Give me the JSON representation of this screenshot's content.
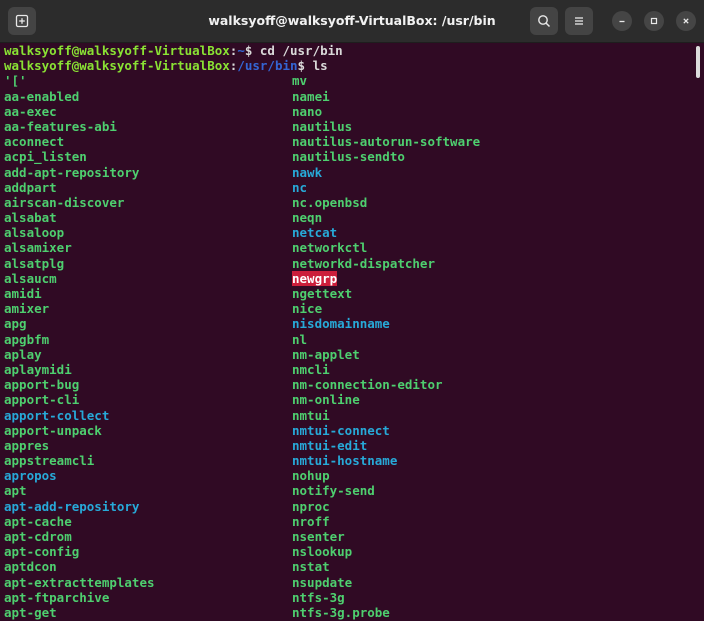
{
  "window": {
    "title": "walksyoff@walksyoff-VirtualBox: /usr/bin"
  },
  "titlebar_icons": {
    "new_tab": "new-tab-icon",
    "search": "search-icon",
    "menu": "hamburger-menu-icon",
    "minimize": "minimize-icon",
    "maximize": "maximize-icon",
    "close": "close-icon"
  },
  "colors": {
    "background": "#300a24",
    "prompt_user": "#8ae234",
    "prompt_path": "#3465d4",
    "executable": "#4ecf6f",
    "symlink": "#27a9d8",
    "setgid_highlight": "#cc1e3b"
  },
  "terminal": {
    "prompts": [
      {
        "user": "walksyoff@walksyoff-VirtualBox",
        "sep": ":",
        "path": "~",
        "sign": "$",
        "command": " cd /usr/bin"
      },
      {
        "user": "walksyoff@walksyoff-VirtualBox",
        "sep": ":",
        "path": "/usr/bin",
        "sign": "$",
        "command": " ls"
      }
    ],
    "col1": [
      {
        "t": "'['",
        "k": "exec"
      },
      {
        "t": "aa-enabled",
        "k": "exec"
      },
      {
        "t": "aa-exec",
        "k": "exec"
      },
      {
        "t": "aa-features-abi",
        "k": "exec"
      },
      {
        "t": "aconnect",
        "k": "exec"
      },
      {
        "t": "acpi_listen",
        "k": "exec"
      },
      {
        "t": "add-apt-repository",
        "k": "exec"
      },
      {
        "t": "addpart",
        "k": "exec"
      },
      {
        "t": "airscan-discover",
        "k": "exec"
      },
      {
        "t": "alsabat",
        "k": "exec"
      },
      {
        "t": "alsaloop",
        "k": "exec"
      },
      {
        "t": "alsamixer",
        "k": "exec"
      },
      {
        "t": "alsatplg",
        "k": "exec"
      },
      {
        "t": "alsaucm",
        "k": "exec"
      },
      {
        "t": "amidi",
        "k": "exec"
      },
      {
        "t": "amixer",
        "k": "exec"
      },
      {
        "t": "apg",
        "k": "exec"
      },
      {
        "t": "apgbfm",
        "k": "exec"
      },
      {
        "t": "aplay",
        "k": "exec"
      },
      {
        "t": "aplaymidi",
        "k": "exec"
      },
      {
        "t": "apport-bug",
        "k": "exec"
      },
      {
        "t": "apport-cli",
        "k": "exec"
      },
      {
        "t": "apport-collect",
        "k": "link"
      },
      {
        "t": "apport-unpack",
        "k": "exec"
      },
      {
        "t": "appres",
        "k": "exec"
      },
      {
        "t": "appstreamcli",
        "k": "exec"
      },
      {
        "t": "apropos",
        "k": "link"
      },
      {
        "t": "apt",
        "k": "exec"
      },
      {
        "t": "apt-add-repository",
        "k": "link"
      },
      {
        "t": "apt-cache",
        "k": "exec"
      },
      {
        "t": "apt-cdrom",
        "k": "exec"
      },
      {
        "t": "apt-config",
        "k": "exec"
      },
      {
        "t": "aptdcon",
        "k": "exec"
      },
      {
        "t": "apt-extracttemplates",
        "k": "exec"
      },
      {
        "t": "apt-ftparchive",
        "k": "exec"
      },
      {
        "t": "apt-get",
        "k": "exec"
      }
    ],
    "col2": [
      {
        "t": "mv",
        "k": "exec"
      },
      {
        "t": "namei",
        "k": "exec"
      },
      {
        "t": "nano",
        "k": "exec"
      },
      {
        "t": "nautilus",
        "k": "exec"
      },
      {
        "t": "nautilus-autorun-software",
        "k": "exec"
      },
      {
        "t": "nautilus-sendto",
        "k": "exec"
      },
      {
        "t": "nawk",
        "k": "link"
      },
      {
        "t": "nc",
        "k": "link"
      },
      {
        "t": "nc.openbsd",
        "k": "exec"
      },
      {
        "t": "neqn",
        "k": "exec"
      },
      {
        "t": "netcat",
        "k": "link"
      },
      {
        "t": "networkctl",
        "k": "exec"
      },
      {
        "t": "networkd-dispatcher",
        "k": "exec"
      },
      {
        "t": "newgrp",
        "k": "hl"
      },
      {
        "t": "ngettext",
        "k": "exec"
      },
      {
        "t": "nice",
        "k": "exec"
      },
      {
        "t": "nisdomainname",
        "k": "link"
      },
      {
        "t": "nl",
        "k": "exec"
      },
      {
        "t": "nm-applet",
        "k": "exec"
      },
      {
        "t": "nmcli",
        "k": "exec"
      },
      {
        "t": "nm-connection-editor",
        "k": "exec"
      },
      {
        "t": "nm-online",
        "k": "exec"
      },
      {
        "t": "nmtui",
        "k": "exec"
      },
      {
        "t": "nmtui-connect",
        "k": "link"
      },
      {
        "t": "nmtui-edit",
        "k": "link"
      },
      {
        "t": "nmtui-hostname",
        "k": "link"
      },
      {
        "t": "nohup",
        "k": "exec"
      },
      {
        "t": "notify-send",
        "k": "exec"
      },
      {
        "t": "nproc",
        "k": "exec"
      },
      {
        "t": "nroff",
        "k": "exec"
      },
      {
        "t": "nsenter",
        "k": "exec"
      },
      {
        "t": "nslookup",
        "k": "exec"
      },
      {
        "t": "nstat",
        "k": "exec"
      },
      {
        "t": "nsupdate",
        "k": "exec"
      },
      {
        "t": "ntfs-3g",
        "k": "exec"
      },
      {
        "t": "ntfs-3g.probe",
        "k": "exec"
      }
    ]
  }
}
